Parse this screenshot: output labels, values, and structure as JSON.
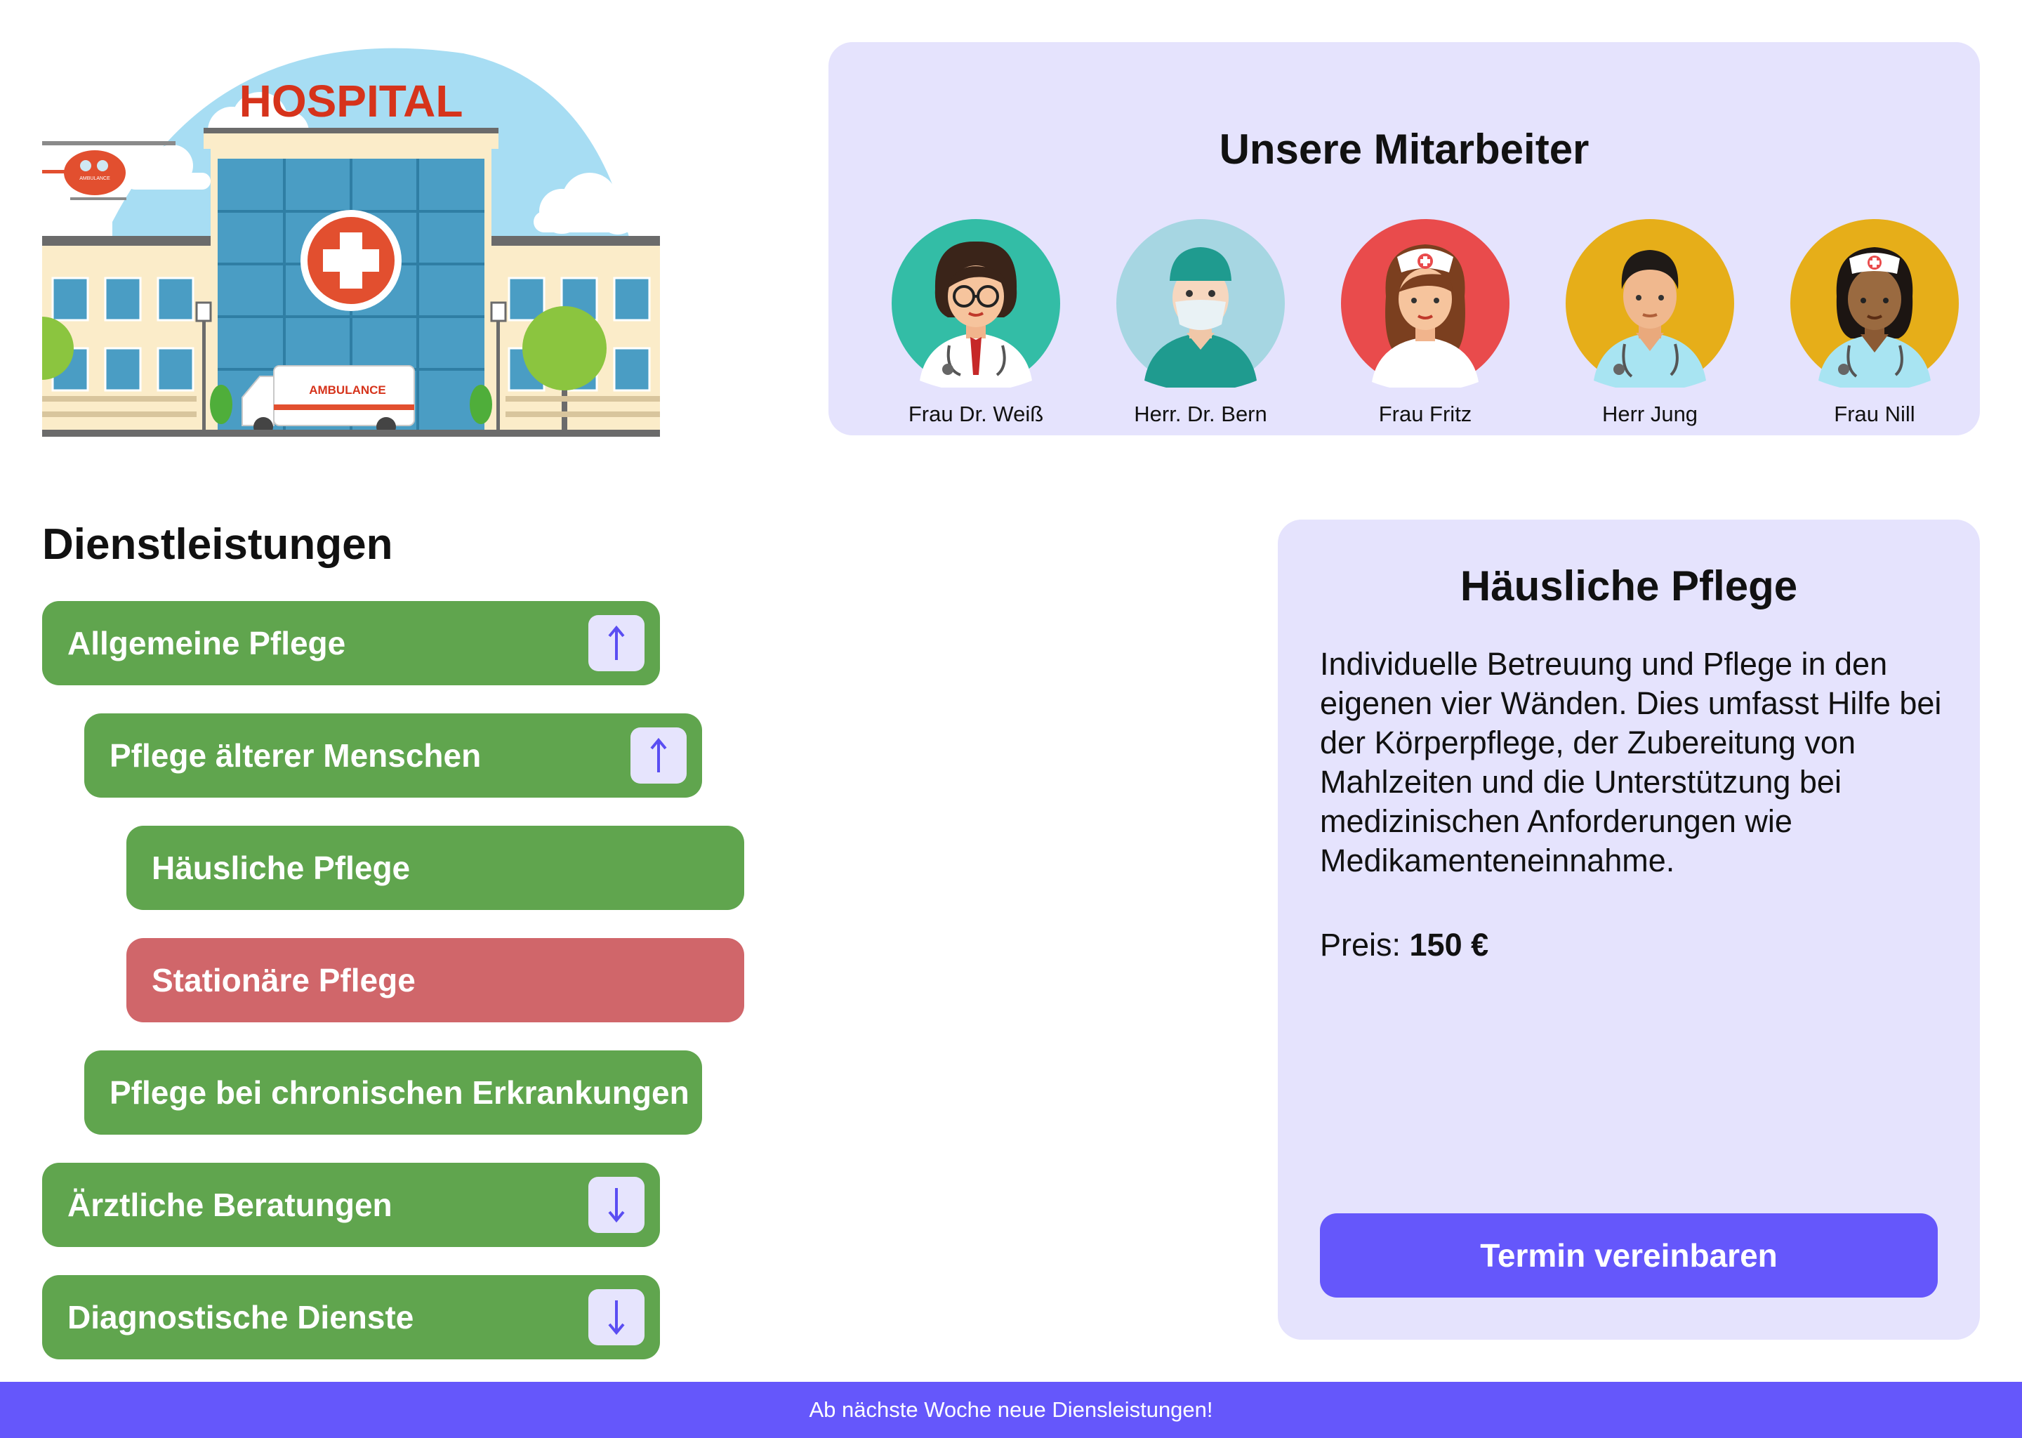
{
  "hero": {
    "hospital_sign": "HOSPITAL",
    "ambulance_text": "AMBULANCE",
    "helicopter_text": "AMBULANCE"
  },
  "staff": {
    "title": "Unsere Mitarbeiter",
    "members": [
      {
        "name": "Frau Dr. Weiß",
        "bg": "#33bda6",
        "icon": "female-doctor-icon"
      },
      {
        "name": "Herr. Dr. Bern",
        "bg": "#a6d6e2",
        "icon": "surgeon-icon"
      },
      {
        "name": "Frau Fritz",
        "bg": "#e94b4c",
        "icon": "female-nurse-icon"
      },
      {
        "name": "Herr Jung",
        "bg": "#e6ae19",
        "icon": "male-nurse-icon"
      },
      {
        "name": "Frau Nill",
        "bg": "#e6ae19",
        "icon": "female-nurse-icon"
      }
    ]
  },
  "services": {
    "title": "Dienstleistungen",
    "items": [
      {
        "label": "Allgemeine Pflege",
        "state": "expanded",
        "arrow": "up"
      },
      {
        "label": "Pflege älterer Menschen",
        "state": "expanded",
        "arrow": "up"
      },
      {
        "label": "Häusliche Pflege",
        "state": "selected"
      },
      {
        "label": "Stationäre Pflege",
        "state": "unavailable"
      },
      {
        "label": "Pflege bei chronischen Erkrankungen",
        "state": "normal"
      },
      {
        "label": "Ärztliche Beratungen",
        "state": "collapsed",
        "arrow": "down"
      },
      {
        "label": "Diagnostische Dienste",
        "state": "collapsed",
        "arrow": "down"
      }
    ]
  },
  "detail": {
    "title": "Häusliche Pflege",
    "description": "Individuelle Betreuung und Pflege in den eigenen vier Wänden. Dies umfasst Hilfe bei der Körperpflege, der Zubereitung von Mahlzeiten und die Unterstützung bei medizinischen Anforderungen wie Medikamenteneinnahme.",
    "price_label": "Preis:",
    "price_value": "150 €",
    "button_label": "Termin vereinbaren"
  },
  "footer": {
    "text": "Ab nächste Woche neue Diensleistungen!"
  },
  "colors": {
    "accent": "#6557fb",
    "card_bg": "#e5e3fd",
    "service_green": "#60a54e",
    "service_red": "#d0666a"
  }
}
